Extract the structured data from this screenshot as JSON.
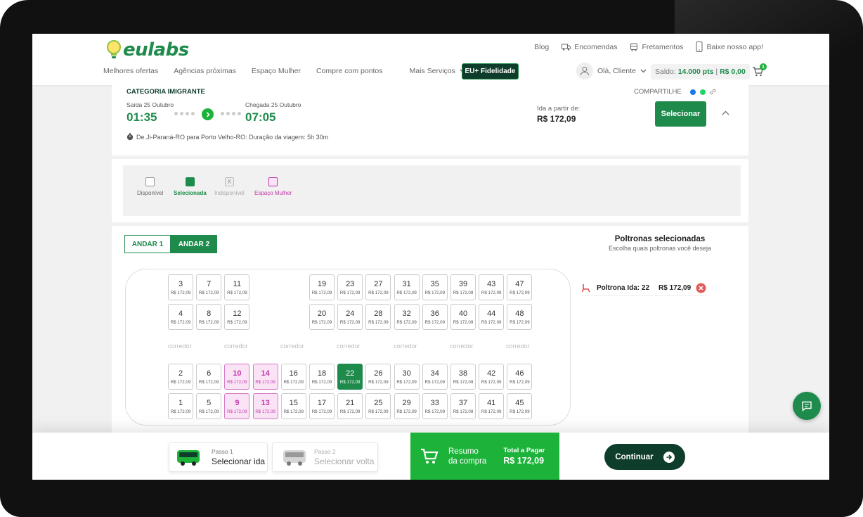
{
  "header": {
    "logo": "eulabs",
    "toplinks": [
      "Blog",
      "Encomendas",
      "Fretamentos",
      "Baixe nosso app!"
    ],
    "nav": [
      "Melhores ofertas",
      "Agências próximas",
      "Espaço Mulher",
      "Compre com pontos",
      "Mais Serviços"
    ],
    "fidelidade": "EU+ Fidelidade",
    "user": "Olá, Cliente",
    "saldo_label": "Saldo:",
    "saldo_pts": "14.000 pts",
    "saldo_sep": "|",
    "saldo_money": "R$ 0,00",
    "cart_count": "1"
  },
  "trip": {
    "category": "CATEGORIA IMIGRANTE",
    "depart_label": "Saída 25 Outubro",
    "depart_time": "01:35",
    "arrive_label": "Chegada 25 Outubro",
    "arrive_time": "07:05",
    "route": "De Ji-Paraná-RO para Porto Velho-RO: Duração da viagem: 5h 30m",
    "share": "COMPARTILHE",
    "price_label": "Ida a partir de:",
    "price": "R$ 172,09",
    "select_button": "Selecionar"
  },
  "legend": {
    "disponivel": "Disponível",
    "selecionada": "Selecionada",
    "indisponivel": "Indisponível",
    "mulher": "Espaço Mulher",
    "x_mark": "X"
  },
  "tabs": [
    "ANDAR 1",
    "ANDAR 2"
  ],
  "seat_price": "R$ 172,09",
  "corredor": "corredor",
  "seats": {
    "top_row1": [
      "3",
      "7",
      "11",
      "19",
      "23",
      "27",
      "31",
      "35",
      "39",
      "43",
      "47"
    ],
    "top_row2": [
      "4",
      "8",
      "12",
      "20",
      "24",
      "28",
      "32",
      "36",
      "40",
      "44",
      "48"
    ],
    "bot_row1": [
      "2",
      "6",
      "10",
      "14",
      "16",
      "18",
      "22",
      "26",
      "30",
      "34",
      "38",
      "42",
      "46"
    ],
    "bot_row2": [
      "1",
      "5",
      "9",
      "13",
      "15",
      "17",
      "21",
      "25",
      "29",
      "33",
      "37",
      "41",
      "45"
    ],
    "mulher": [
      "9",
      "10",
      "13",
      "14"
    ],
    "selected": [
      "22"
    ]
  },
  "side": {
    "title": "Poltronas selecionadas",
    "subtitle": "Escolha quais poltronas você deseja",
    "item_label": "Poltrona Ida: 22",
    "item_price": "R$ 172,09"
  },
  "bottom": {
    "step1_small": "Passo 1",
    "step1_big": "Selecionar ida",
    "step2_small": "Passo 2",
    "step2_big": "Selecionar volta",
    "resumo1": "Resumo",
    "resumo2": "da compra",
    "total_label": "Total a Pagar",
    "total_value": "R$ 172,09",
    "continue": "Continuar"
  },
  "colors": {
    "brand": "#1e8b4c",
    "dark": "#0f3d2b",
    "accent": "#1db33a",
    "mulher": "#c13aa9"
  }
}
